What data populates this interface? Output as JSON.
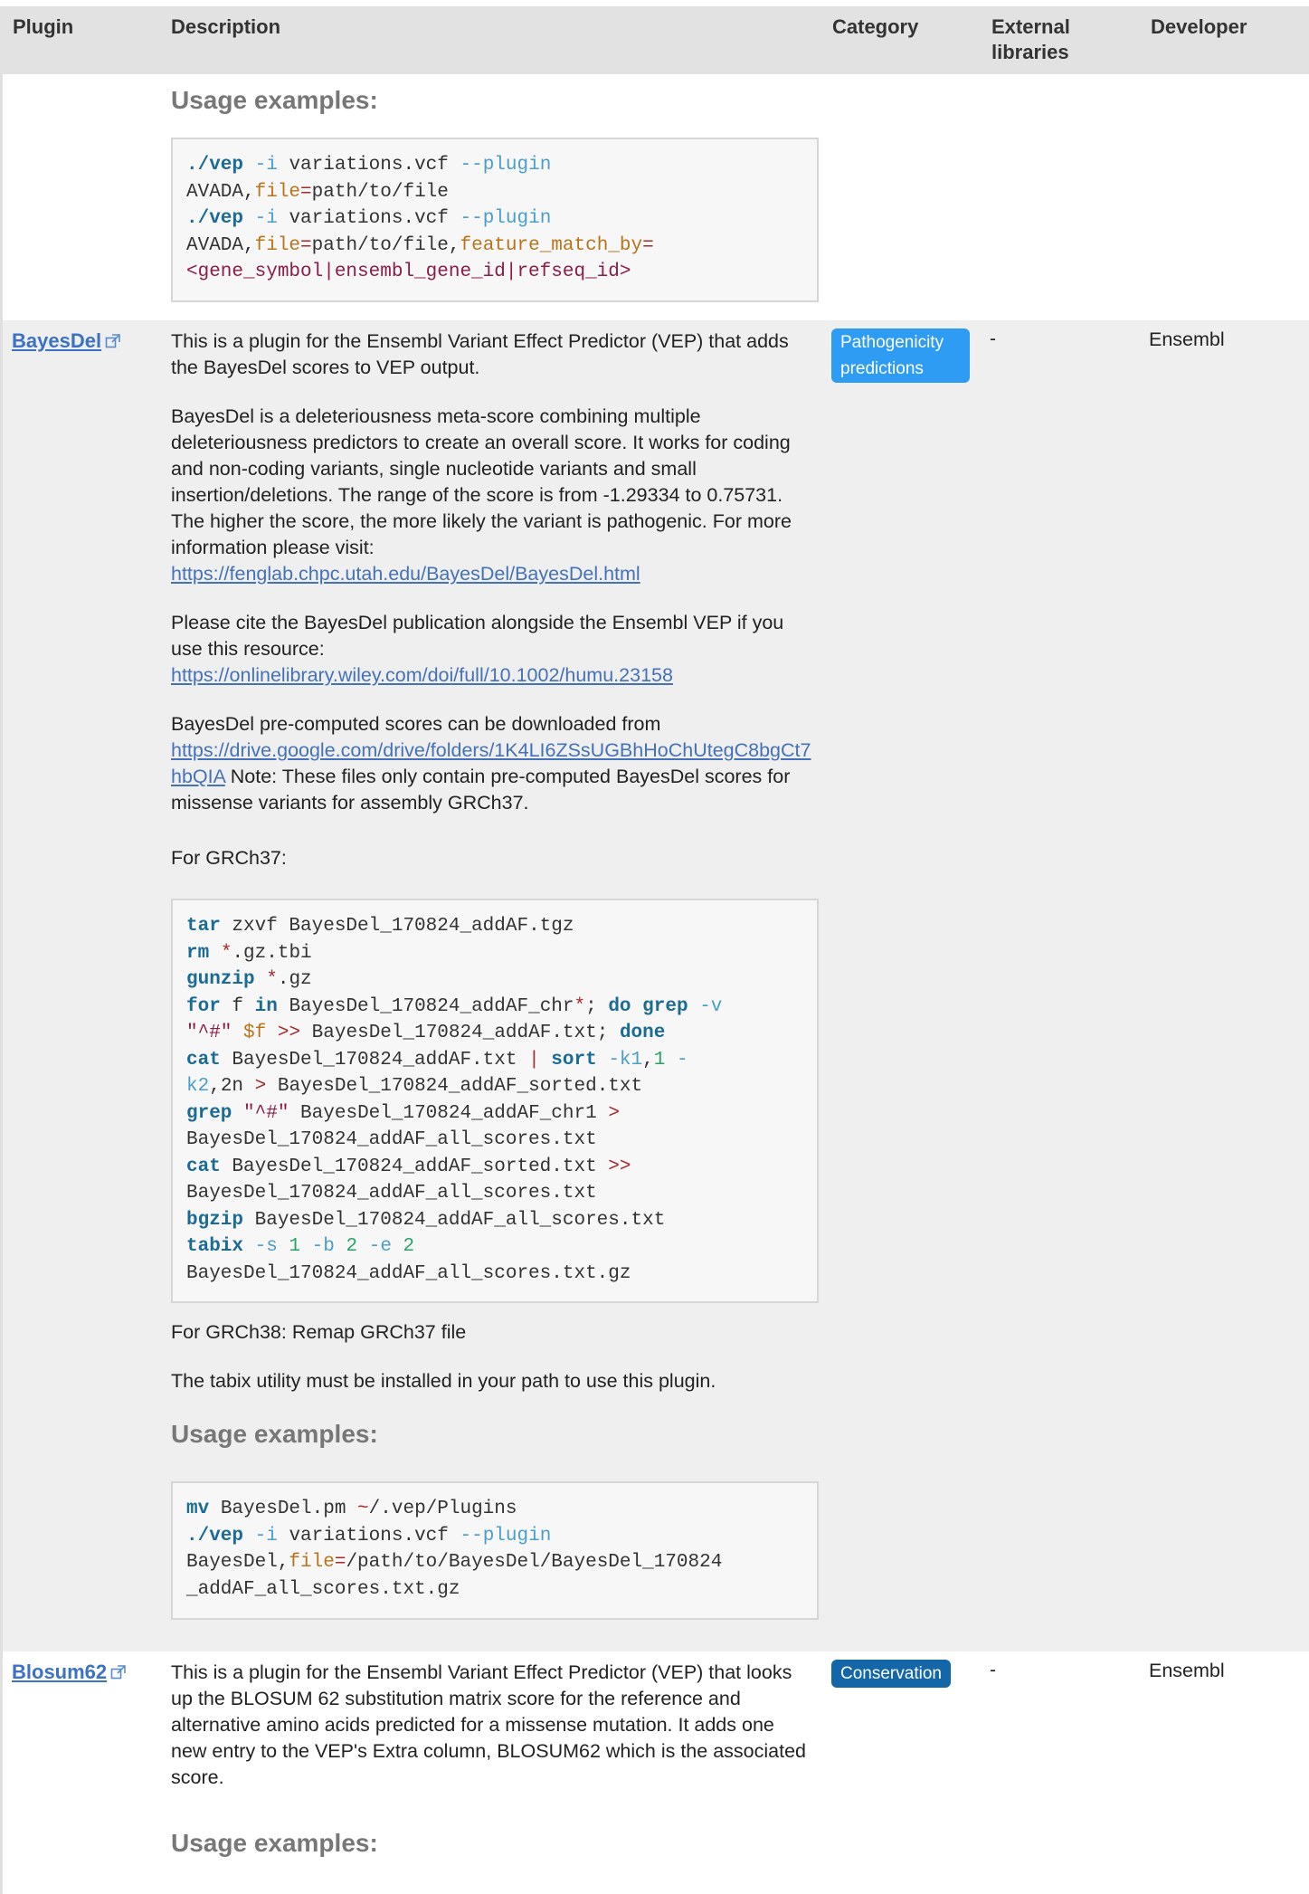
{
  "header": {
    "plugin": "Plugin",
    "description": "Description",
    "category": "Category",
    "external_libraries": "External libraries",
    "developer": "Developer"
  },
  "avada": {
    "usage_heading": "Usage examples:",
    "code": [
      "./vep -i variations.vcf --plugin",
      "AVADA,file=path/to/file",
      "./vep -i variations.vcf --plugin",
      "AVADA,file=path/to/file,feature_match_by=",
      "<gene_symbol|ensembl_gene_id|refseq_id>"
    ]
  },
  "bayesdel": {
    "name": "BayesDel",
    "category": "Pathogenicity predictions",
    "external_libraries": "-",
    "developer": "Ensembl",
    "intro": "This is a plugin for the Ensembl Variant Effect Predictor (VEP) that adds the BayesDel scores to VEP output.",
    "about": "BayesDel is a deleteriousness meta-score combining multiple deleteriousness predictors to create an overall score. It works for coding and non-coding variants, single nucleotide variants and small insertion/deletions. The range of the score is from -1.29334 to 0.75731. The higher the score, the more likely the variant is pathogenic. For more information please visit:",
    "about_link": "https://fenglab.chpc.utah.edu/BayesDel/BayesDel.html",
    "cite": "Please cite the BayesDel publication alongside the Ensembl VEP if you use this resource:",
    "cite_link": "https://onlinelibrary.wiley.com/doi/full/10.1002/humu.23158",
    "download": "BayesDel pre-computed scores can be downloaded from",
    "download_link": "https://drive.google.com/drive/folders/1K4LI6ZSsUGBhHoChUtegC8bgCt7hbQIA",
    "download_note": " Note: These files only contain pre-computed BayesDel scores for missense variants for assembly GRCh37.",
    "grch37": "For GRCh37:",
    "grch37_code": [
      "tar zxvf BayesDel_170824_addAF.tgz",
      "rm *.gz.tbi",
      "gunzip *.gz",
      "for f in BayesDel_170824_addAF_chr*; do grep -v",
      "\"^#\" $f >> BayesDel_170824_addAF.txt; done",
      "cat BayesDel_170824_addAF.txt | sort -k1,1 -",
      "k2,2n > BayesDel_170824_addAF_sorted.txt",
      "grep \"^#\" BayesDel_170824_addAF_chr1 >",
      "BayesDel_170824_addAF_all_scores.txt",
      "cat BayesDel_170824_addAF_sorted.txt >>",
      "BayesDel_170824_addAF_all_scores.txt",
      "bgzip BayesDel_170824_addAF_all_scores.txt",
      "tabix -s 1 -b 2 -e 2",
      "BayesDel_170824_addAF_all_scores.txt.gz"
    ],
    "grch38": "For GRCh38: Remap GRCh37 file",
    "tabix_note": "The tabix utility must be installed in your path to use this plugin.",
    "usage_heading": "Usage examples:",
    "usage_code": [
      "mv BayesDel.pm ~/.vep/Plugins",
      "./vep -i variations.vcf --plugin",
      "BayesDel,file=/path/to/BayesDel/BayesDel_170824",
      "_addAF_all_scores.txt.gz"
    ]
  },
  "blosum62": {
    "name": "Blosum62",
    "category": "Conservation",
    "external_libraries": "-",
    "developer": "Ensembl",
    "intro": "This is a plugin for the Ensembl Variant Effect Predictor (VEP) that looks up the BLOSUM 62 substitution matrix score for the reference and alternative amino acids predicted for a missense mutation. It adds one new entry to the VEP's Extra column, BLOSUM62 which is the associated score.",
    "usage_heading": "Usage examples:"
  },
  "colors": {
    "header_bg": "#e2e2e2",
    "row_alt_bg": "#efefef",
    "link": "#4572b7",
    "badge_pathogenicity": "#2e9cf3",
    "badge_conservation": "#1367a8"
  }
}
